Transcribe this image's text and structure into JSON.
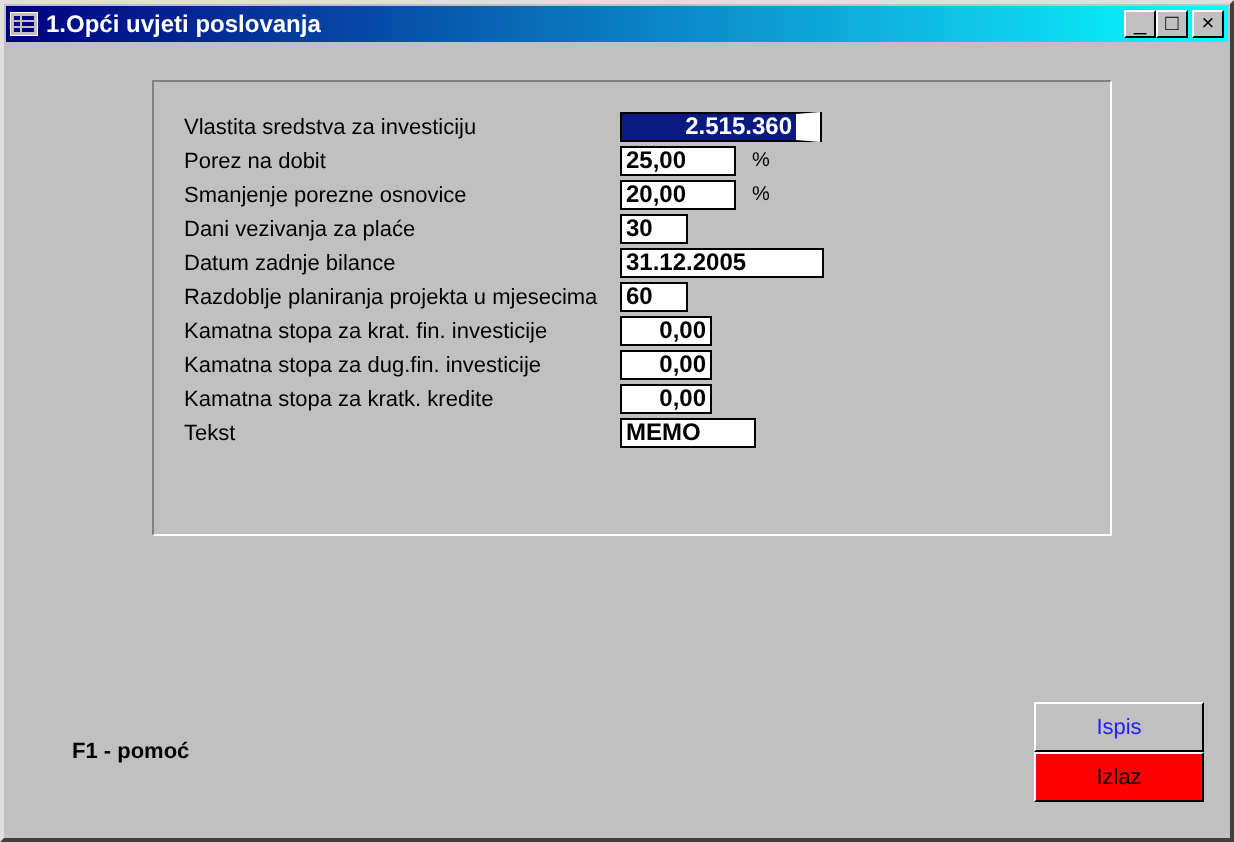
{
  "window": {
    "title": "1.Opći uvjeti poslovanja",
    "controls": [
      "_",
      "□",
      "×"
    ]
  },
  "fields": [
    {
      "label": "Vlastita sredstva za investiciju",
      "value": "2.515.360",
      "kind": "amount",
      "selected": true
    },
    {
      "label": "Porez na dobit",
      "value": "25,00",
      "kind": "percent",
      "unit": "%",
      "selected": false
    },
    {
      "label": "Smanjenje porezne osnovice",
      "value": "20,00",
      "kind": "percent",
      "unit": "%",
      "selected": false
    },
    {
      "label": "Dani vezivanja za plaće",
      "value": "30",
      "kind": "short",
      "selected": false
    },
    {
      "label": "Datum zadnje  bilance",
      "value": "31.12.2005",
      "kind": "date",
      "selected": false
    },
    {
      "label": "Razdoblje planiranja projekta u mjesecima",
      "value": "60",
      "kind": "short",
      "selected": false
    },
    {
      "label": "Kamatna stopa za krat. fin. investicije",
      "value": "0,00",
      "kind": "rate",
      "selected": false
    },
    {
      "label": "Kamatna stopa za dug.fin. investicije",
      "value": "0,00",
      "kind": "rate",
      "selected": false
    },
    {
      "label": "Kamatna stopa za kratk. kredite",
      "value": "0,00",
      "kind": "rate",
      "selected": false
    },
    {
      "label": "Tekst",
      "value": "MEMO",
      "kind": "memo",
      "selected": false
    }
  ],
  "help": "F1 - pomoć",
  "buttons": [
    {
      "label": "Ispis",
      "kind": "print"
    },
    {
      "label": "Izlaz",
      "kind": "exit"
    }
  ]
}
